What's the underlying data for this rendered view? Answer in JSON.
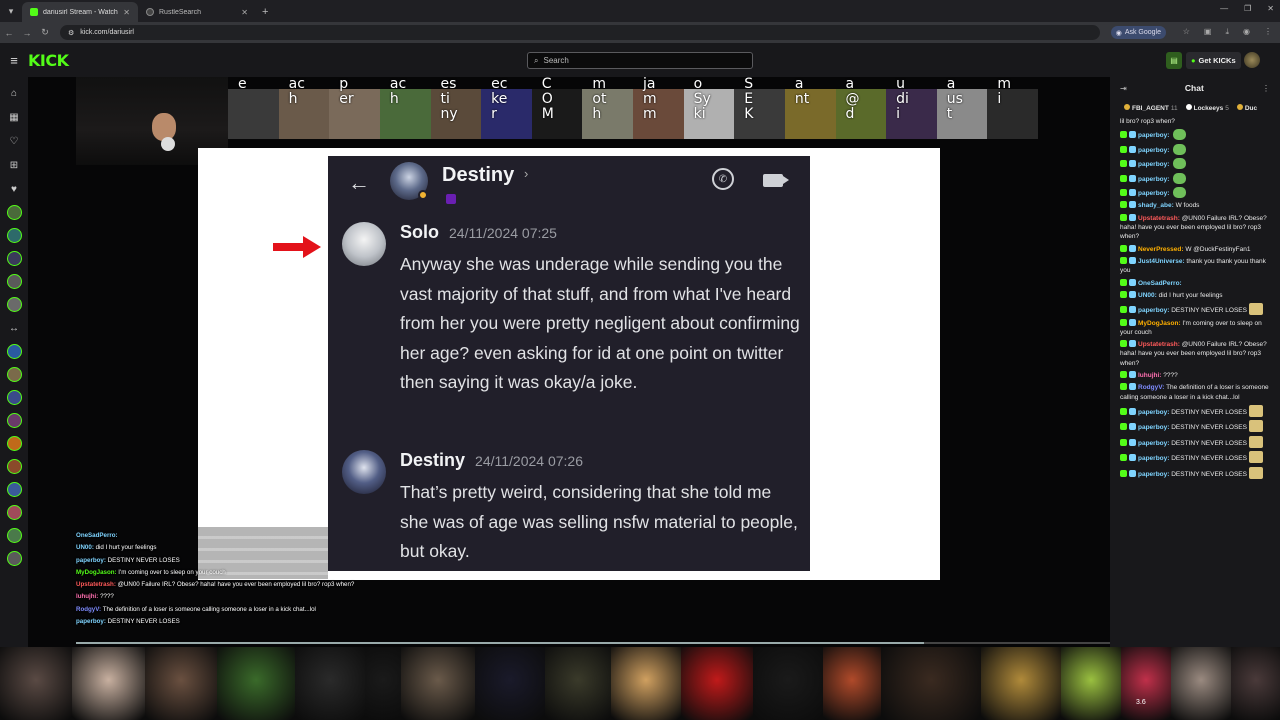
{
  "browser": {
    "tabs": [
      {
        "title": "dariusirl Stream - Watch Live o"
      },
      {
        "title": "RustleSearch"
      }
    ],
    "new_tab": "+",
    "url": "kick.com/dariusirl",
    "ask_google": "Ask Google",
    "window_controls": [
      "—",
      "❐",
      "✕"
    ]
  },
  "header": {
    "logo": "KICK",
    "search_placeholder": "Search",
    "get_kicks": "Get KICKs"
  },
  "stream": {
    "emote_letters": [
      "e",
      "ac\nh",
      "p\ner",
      "ac\nh",
      "es\nti\nny",
      "ec\nke\nr",
      "C\nO\nM",
      "m\not\nh",
      "ja\nm\nm",
      "o\nSy\nki",
      "S\nE\nK",
      "a\nnt",
      "a\n@\nd",
      "u\ndi\ni",
      "a\nus\nt",
      "m\ni"
    ],
    "progress_fraction": 0.82
  },
  "discord": {
    "contact_name": "Destiny",
    "messages": [
      {
        "author": "Solo",
        "timestamp": "24/11/2024 07:25",
        "text": "Anyway she was underage while sending you the vast majority of that stuff, and from what I've heard from her you were pretty negligent about confirming her age? even asking for id at one point on twitter then saying it was okay/a joke."
      },
      {
        "author": "Destiny",
        "timestamp": "24/11/2024 07:26",
        "text": "That’s pretty weird, considering that she told me she was of age was selling nsfw material to people, but okay."
      }
    ]
  },
  "overlay_chat": [
    {
      "user": "OneSadPerro",
      "text": "",
      "color": "#7fd4ff"
    },
    {
      "user": "UN00",
      "text": "did I hurt your feelings",
      "color": "#7fd4ff"
    },
    {
      "user": "paperboy",
      "text": "DESTINY NEVER LOSES",
      "color": "#7fd4ff"
    },
    {
      "user": "MyDogJason",
      "text": "I'm coming over to sleep on your couch",
      "color": "#53fc18"
    },
    {
      "user": "Upstatetrash",
      "text": "@UN00 Failure IRL? Obese? haha! have you ever been employed lil bro? rop3 when?",
      "color": "#ff5a5a"
    },
    {
      "user": "luhujhi",
      "text": "????",
      "color": "#ff6fb0"
    },
    {
      "user": "RodgyV",
      "text": "The definition of a loser is someone calling someone a loser in a kick chat...lol",
      "color": "#7f8cff"
    },
    {
      "user": "paperboy",
      "text": "DESTINY NEVER LOSES",
      "color": "#7fd4ff"
    }
  ],
  "chat": {
    "title": "Chat",
    "pinned": [
      {
        "name": "FBI_AGENT",
        "count": "11",
        "color": "#e0b03a"
      },
      {
        "name": "Lockeeys",
        "count": "5",
        "color": "#ffffff"
      },
      {
        "name": "Duc",
        "count": "",
        "color": "#e0b03a"
      }
    ],
    "messages": [
      {
        "user": "",
        "text": "lil bro? rop3 when?",
        "color": "#e9e9e9"
      },
      {
        "user": "paperboy",
        "text": "",
        "color": "#7fd4ff"
      },
      {
        "user": "paperboy",
        "text": "",
        "color": "#7fd4ff"
      },
      {
        "user": "paperboy",
        "text": "",
        "color": "#7fd4ff"
      },
      {
        "user": "paperboy",
        "text": "",
        "color": "#7fd4ff"
      },
      {
        "user": "paperboy",
        "text": "",
        "color": "#7fd4ff"
      },
      {
        "user": "shady_abe",
        "text": "W foods",
        "color": "#7fd4ff"
      },
      {
        "user": "Upstatetrash",
        "text": "@UN00 Failure IRL? Obese? haha! have you ever been employed lil bro? rop3 when?",
        "color": "#ff5a5a"
      },
      {
        "user": "NeverPressed",
        "text": "W @DuckFestinyFan1",
        "color": "#ffb000"
      },
      {
        "user": "Just4Universe",
        "text": "thank you thank youu thank you",
        "color": "#7fd4ff"
      },
      {
        "user": "OneSadPerro",
        "text": "",
        "color": "#7fd4ff"
      },
      {
        "user": "UN00",
        "text": "did I hurt your feelings",
        "color": "#7fd4ff"
      },
      {
        "user": "paperboy",
        "text": "DESTINY NEVER LOSES",
        "color": "#7fd4ff"
      },
      {
        "user": "MyDogJason",
        "text": "I'm coming over to sleep on your couch",
        "color": "#ffb000"
      },
      {
        "user": "Upstatetrash",
        "text": "@UN00 Failure IRL? Obese? haha! have you ever been employed lil bro? rop3 when?",
        "color": "#ff5a5a"
      },
      {
        "user": "luhujhi",
        "text": "????",
        "color": "#ff6fb0"
      },
      {
        "user": "RodgyV",
        "text": "The definition of a loser is someone calling someone a loser in a kick chat...lol",
        "color": "#7f8cff"
      },
      {
        "user": "paperboy",
        "text": "DESTINY NEVER LOSES",
        "color": "#7fd4ff"
      },
      {
        "user": "paperboy",
        "text": "DESTINY NEVER LOSES",
        "color": "#7fd4ff"
      },
      {
        "user": "paperboy",
        "text": "DESTINY NEVER LOSES",
        "color": "#7fd4ff"
      },
      {
        "user": "paperboy",
        "text": "DESTINY NEVER LOSES",
        "color": "#7fd4ff"
      },
      {
        "user": "paperboy",
        "text": "DESTINY NEVER LOSES",
        "color": "#7fd4ff"
      }
    ]
  },
  "bottom_overlay_number": "3.6"
}
